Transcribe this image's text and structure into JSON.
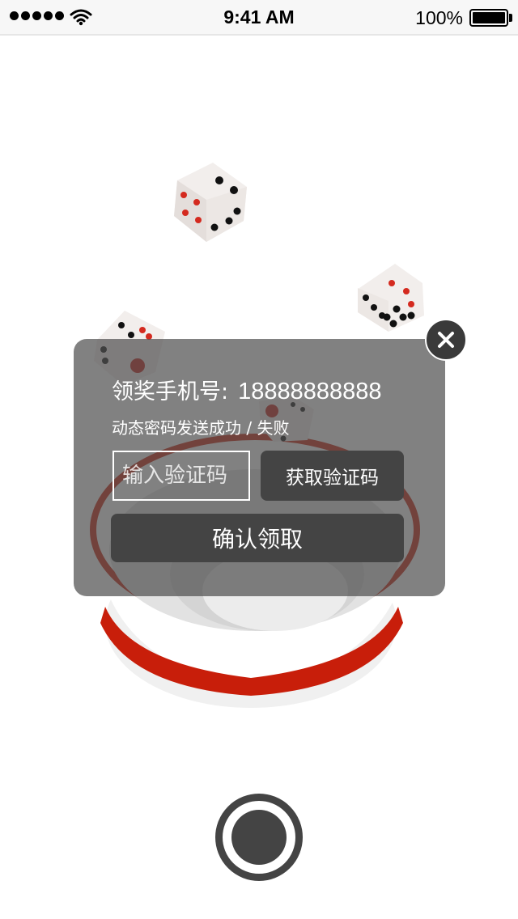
{
  "status_bar": {
    "time": "9:41 AM",
    "battery_percent": "100%",
    "signal_icon": "signal-dots-icon",
    "wifi_icon": "wifi-icon",
    "battery_icon": "battery-icon"
  },
  "modal": {
    "phone_label": "领奖手机号:",
    "phone_value": "18888888888",
    "status_text": "动态密码发送成功 / 失败",
    "code_placeholder": "输入验证码",
    "get_code_label": "获取验证码",
    "confirm_label": "确认领取",
    "close_icon": "close-icon"
  },
  "record_button": {
    "icon": "record-icon"
  },
  "colors": {
    "modal_overlay": "#505050",
    "button": "#444444",
    "bowl_red": "#c81e0a",
    "dice_pip_red": "#d42a1f",
    "dice_pip_black": "#111111"
  }
}
